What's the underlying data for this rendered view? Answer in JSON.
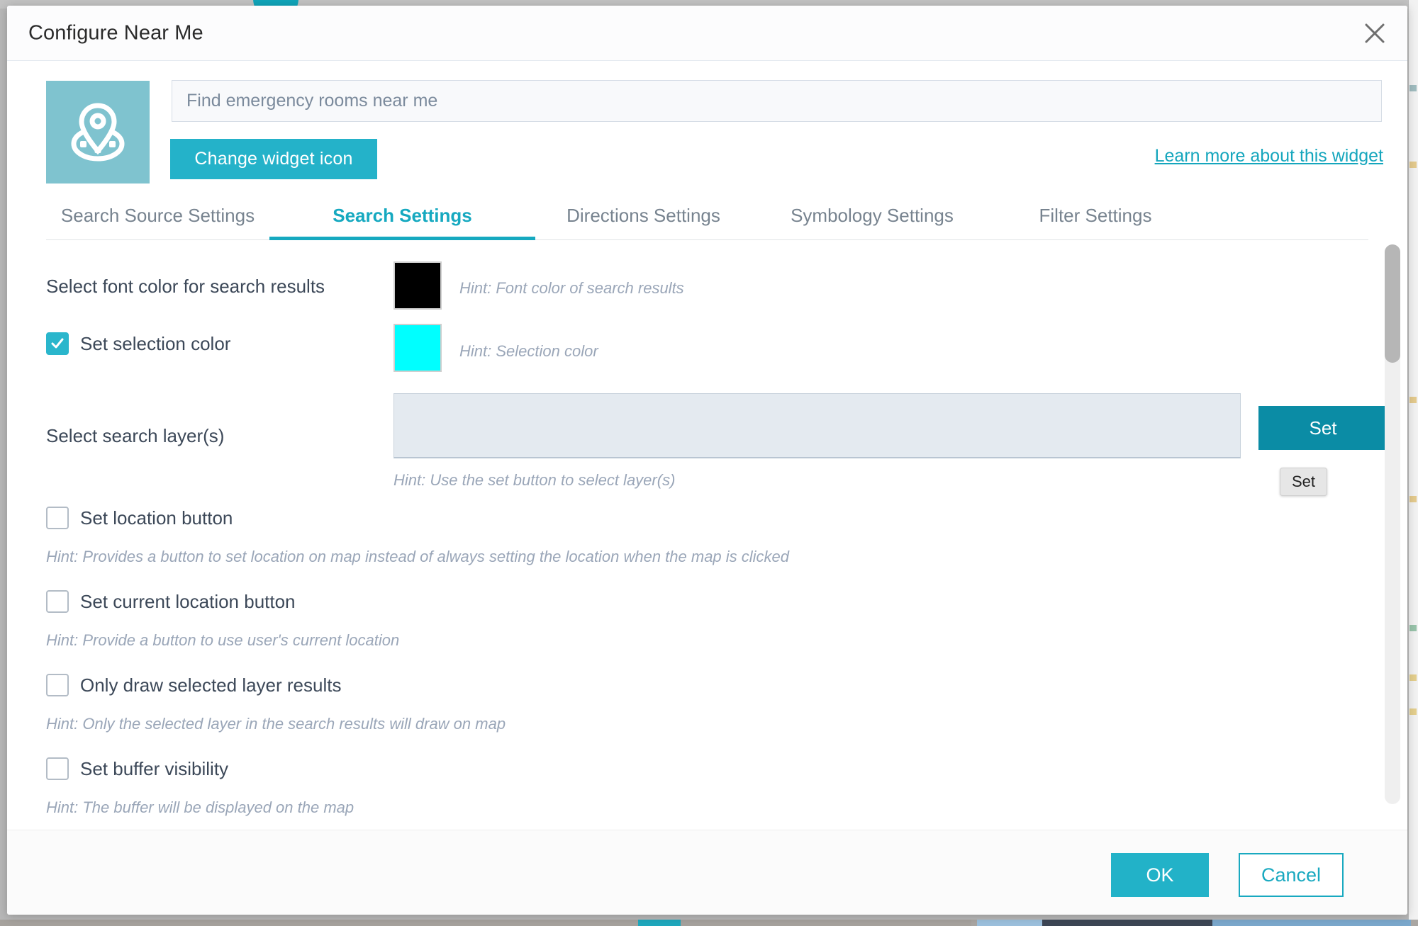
{
  "dialog": {
    "title": "Configure Near Me",
    "close_icon": "close-icon"
  },
  "widget": {
    "icon_name": "map-pin-near-me-icon",
    "icon_tile_color": "#7fc3cf",
    "name_value": "Find emergency rooms near me",
    "name_placeholder": "Find emergency rooms near me",
    "change_icon_label": "Change widget icon",
    "learn_more_label": "Learn more about this widget"
  },
  "tabs": [
    {
      "label": "Search Source Settings",
      "active": false
    },
    {
      "label": "Search Settings",
      "active": true
    },
    {
      "label": "Directions Settings",
      "active": false
    },
    {
      "label": "Symbology Settings",
      "active": false
    },
    {
      "label": "Filter Settings",
      "active": false
    }
  ],
  "settings": {
    "font_color": {
      "label": "Select font color for search results",
      "swatch_color": "#000000",
      "hint": "Hint: Font color of search results"
    },
    "selection_color": {
      "label": "Set selection color",
      "checked": true,
      "swatch_color": "#00ffff",
      "hint": "Hint: Selection color"
    },
    "search_layers": {
      "label": "Select search layer(s)",
      "value": "",
      "set_button_label": "Set",
      "set_tooltip": "Set",
      "hint": "Hint: Use the set button to select layer(s)"
    },
    "set_location_button": {
      "label": "Set location button",
      "checked": false,
      "hint": "Hint: Provides a button to set location on map instead of always setting the location when the map is clicked"
    },
    "set_current_location_button": {
      "label": "Set current location button",
      "checked": false,
      "hint": "Hint: Provide a button to use user's current location"
    },
    "only_draw_selected": {
      "label": "Only draw selected layer results",
      "checked": false,
      "hint": "Hint: Only the selected layer in the search results will draw on map"
    },
    "buffer_visibility": {
      "label": "Set buffer visibility",
      "checked": false,
      "hint": "Hint: The buffer will be displayed on the map"
    }
  },
  "footer": {
    "ok_label": "OK",
    "cancel_label": "Cancel"
  },
  "theme": {
    "accent": "#22b2c8",
    "accent_dark": "#0b8ca5",
    "link": "#15a6bd",
    "label_text": "#3c4858",
    "hint_text": "#9aa6b8"
  }
}
